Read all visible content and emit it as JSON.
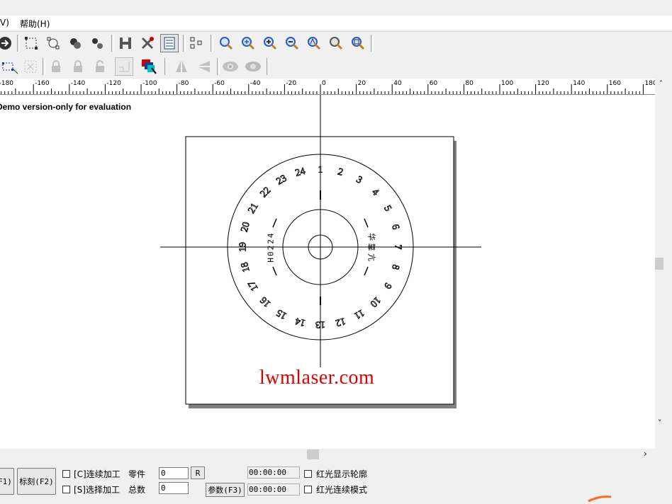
{
  "menu": {
    "view_fragment": "V)",
    "help": "帮助(H)"
  },
  "toolbar1": {
    "icons": [
      "arrow-right-icon",
      "select-box-icon",
      "node-edit-icon",
      "group-icon",
      "ungroup-icon",
      "h-icon",
      "tools-icon",
      "list-icon",
      "grid-icon",
      "zoom-icon",
      "zoom-plus-icon",
      "zoom-in-icon",
      "zoom-out-icon",
      "zoom-a-icon",
      "zoom-all-icon",
      "zoom-page-icon"
    ]
  },
  "toolbar2": {
    "icons": [
      "select-grid-icon",
      "dots-icon",
      "lock-icon",
      "lock-icon",
      "lock-icon",
      "corner-icon",
      "color-icon",
      "mirror-h-icon",
      "mirror-v-icon",
      "eye-icon",
      "eye-icon"
    ]
  },
  "ruler": {
    "ticks": [
      "-180",
      "-160",
      "-140",
      "-120",
      "-100",
      "-80",
      "-60",
      "-40",
      "-20",
      "0",
      "20",
      "40",
      "60",
      "80",
      "100",
      "120",
      "140",
      "160",
      "180"
    ]
  },
  "canvas": {
    "demo_notice": "Demo version-only for evaluation",
    "watermark": "lwmlaser.com",
    "watermark_color": "#e00000",
    "dial_numbers": [
      "1",
      "2",
      "3",
      "4",
      "5",
      "6",
      "7",
      "8",
      "9",
      "10",
      "11",
      "12",
      "13",
      "14",
      "15",
      "16",
      "17",
      "18",
      "19",
      "20",
      "21",
      "22",
      "23",
      "24"
    ],
    "inner_left_text": "H0224",
    "inner_right_text": "华 靠 亢"
  },
  "bottom": {
    "f1_fragment": "F1)",
    "mark_button": "标刻(F2)",
    "continuous_label": "[C]连续加工",
    "select_label": "[S]选择加工",
    "parts_label": "零件",
    "total_label": "总数",
    "parts_value": "0",
    "total_value": "0",
    "r_button": "R",
    "params_button": "参数(F3)",
    "time1": "00:00:00",
    "time2": "00:00:00",
    "red_outline_label": "红光显示轮廓",
    "red_continuous_label": "红光连续模式"
  }
}
